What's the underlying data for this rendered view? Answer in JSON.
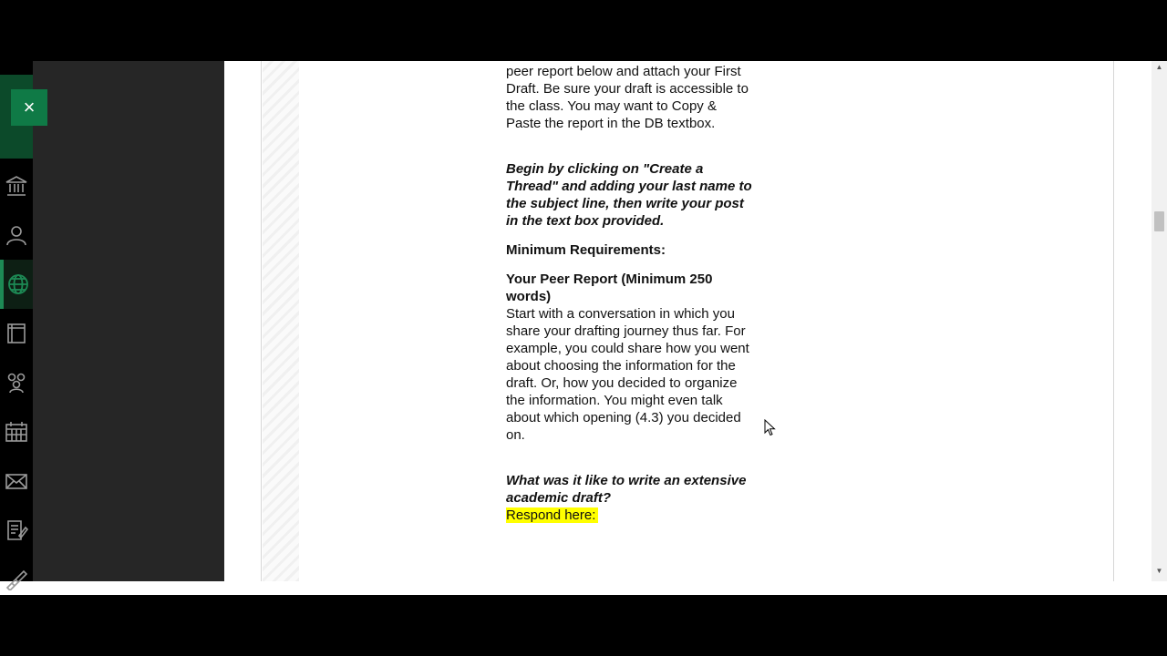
{
  "sidebar": {
    "close_symbol": "×",
    "icons": [
      "institution-icon",
      "profile-icon",
      "courses-globe-icon",
      "organizations-icon",
      "groups-icon",
      "calendar-icon",
      "messages-icon",
      "grades-icon",
      "tools-icon"
    ]
  },
  "document": {
    "intro_lines": "peer report below and attach your First Draft. Be sure your draft is accessible to the class. You may want to Copy & Paste the report in the DB textbox.",
    "instructions": "Begin by clicking on \"Create a Thread\" and adding your last name to the subject line, then write your post in the text box provided.",
    "min_req_heading": "Minimum Requirements:",
    "peer_report_heading": "Your Peer Report (Minimum 250 words)",
    "peer_report_body": "Start with a conversation in which you share your drafting journey thus far. For example, you could share how you went about choosing the information for the draft. Or, how you decided to organize the information. You might even talk about which opening (4.3) you decided on.",
    "question": "What was it like to write an extensive academic draft?",
    "respond_prompt": "Respond here:"
  },
  "colors": {
    "accent_green": "#0f7a46",
    "highlight": "#ffff00",
    "drawer_bg": "#262626"
  }
}
